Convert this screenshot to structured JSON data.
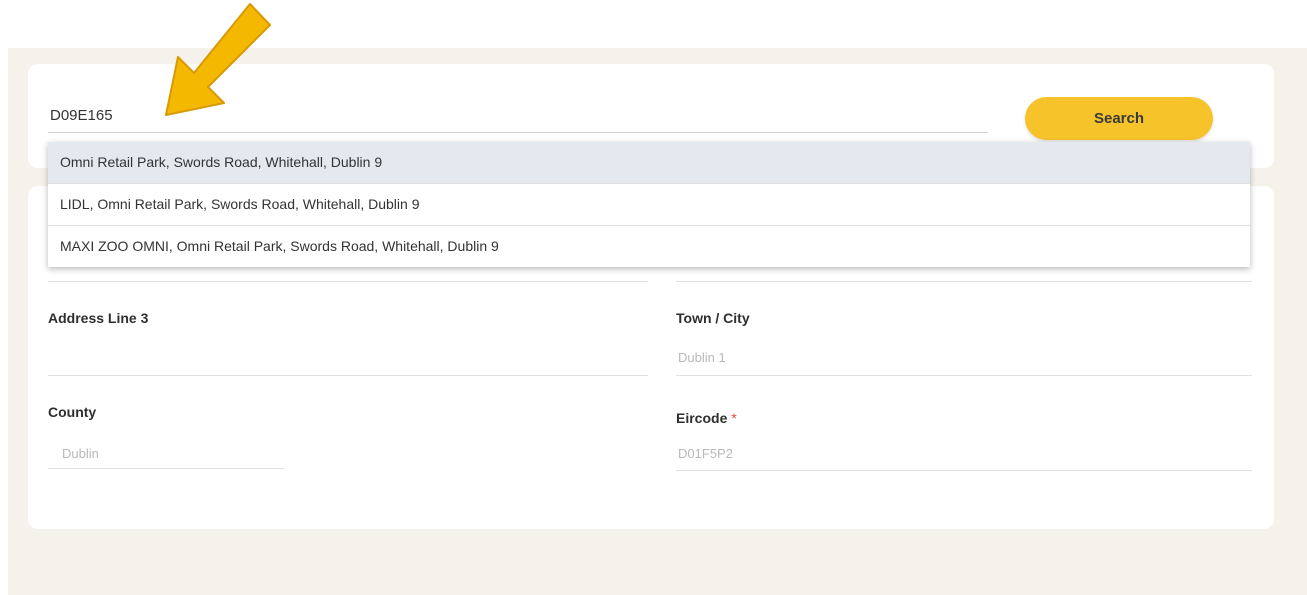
{
  "search": {
    "value": "D09E165",
    "button_label": "Search"
  },
  "suggestions": [
    "Omni Retail Park, Swords Road, Whitehall, Dublin 9",
    "LIDL, Omni Retail Park, Swords Road, Whitehall, Dublin 9",
    "MAXI ZOO OMNI, Omni Retail Park, Swords Road, Whitehall, Dublin 9"
  ],
  "form": {
    "address_line_3": {
      "label": "Address Line 3",
      "value": ""
    },
    "town_city": {
      "label": "Town / City",
      "value": "Dublin 1"
    },
    "county": {
      "label": "County",
      "value": "Dublin"
    },
    "eircode": {
      "label": "Eircode",
      "required_mark": "*",
      "value": "D01F5P2"
    }
  },
  "colors": {
    "accent": "#f6c32b",
    "background": "#f4f2ea",
    "highlight": "#e4e8ef",
    "arrow": "#f5b800"
  },
  "annotation": {
    "icon": "arrow-down-left-icon"
  }
}
